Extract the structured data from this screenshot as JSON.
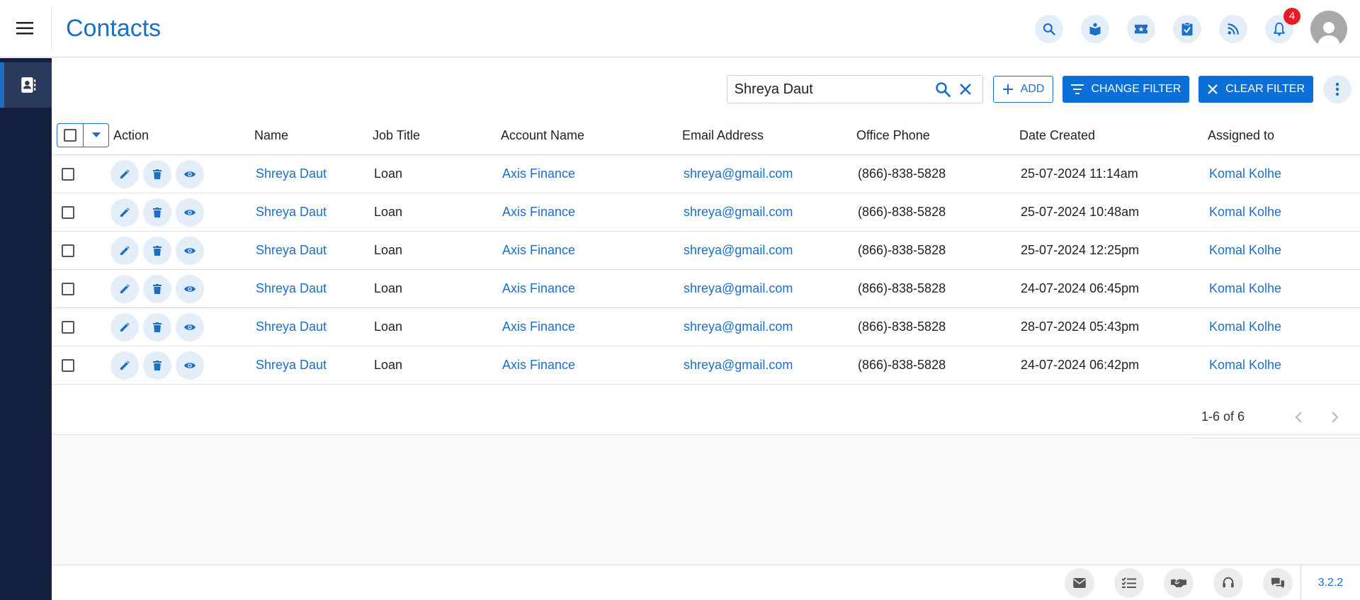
{
  "header": {
    "title": "Contacts",
    "notification_count": "4",
    "icons": [
      "search-icon",
      "knowledge-book-icon",
      "ticket-icon",
      "task-clipboard-icon",
      "rss-feed-icon",
      "bell-icon",
      "user-avatar-icon"
    ]
  },
  "sidebar": {
    "items": [
      {
        "icon": "contacts-book-icon",
        "active": true
      }
    ]
  },
  "toolbar": {
    "search_value": "Shreya Daut",
    "add_label": "ADD",
    "change_filter_label": "CHANGE FILTER",
    "clear_filter_label": "CLEAR FILTER"
  },
  "table": {
    "columns": [
      "Action",
      "Name",
      "Job Title",
      "Account Name",
      "Email Address",
      "Office Phone",
      "Date Created",
      "Assigned to"
    ],
    "rows": [
      {
        "name": "Shreya Daut",
        "job_title": "Loan",
        "account": "Axis Finance",
        "email": "shreya@gmail.com",
        "phone": "(866)-838-5828",
        "created": "25-07-2024 11:14am",
        "assigned": "Komal Kolhe"
      },
      {
        "name": "Shreya Daut",
        "job_title": "Loan",
        "account": "Axis Finance",
        "email": "shreya@gmail.com",
        "phone": "(866)-838-5828",
        "created": "25-07-2024 10:48am",
        "assigned": "Komal Kolhe"
      },
      {
        "name": "Shreya Daut",
        "job_title": "Loan",
        "account": "Axis Finance",
        "email": "shreya@gmail.com",
        "phone": "(866)-838-5828",
        "created": "25-07-2024 12:25pm",
        "assigned": "Komal Kolhe"
      },
      {
        "name": "Shreya Daut",
        "job_title": "Loan",
        "account": "Axis Finance",
        "email": "shreya@gmail.com",
        "phone": "(866)-838-5828",
        "created": "24-07-2024 06:45pm",
        "assigned": "Komal Kolhe"
      },
      {
        "name": "Shreya Daut",
        "job_title": "Loan",
        "account": "Axis Finance",
        "email": "shreya@gmail.com",
        "phone": "(866)-838-5828",
        "created": "28-07-2024 05:43pm",
        "assigned": "Komal Kolhe"
      },
      {
        "name": "Shreya Daut",
        "job_title": "Loan",
        "account": "Axis Finance",
        "email": "shreya@gmail.com",
        "phone": "(866)-838-5828",
        "created": "24-07-2024 06:42pm",
        "assigned": "Komal Kolhe"
      }
    ]
  },
  "pagination": {
    "range_text": "1-6 of 6"
  },
  "footer": {
    "icons": [
      "email-icon",
      "task-list-icon",
      "handshake-icon",
      "headset-icon",
      "chat-icon"
    ],
    "version": "3.2.2"
  },
  "colors": {
    "brand": "#1a6fc9",
    "sidebar": "#13203f",
    "primary_button": "#0a6fd6",
    "badge": "#e51c23"
  }
}
